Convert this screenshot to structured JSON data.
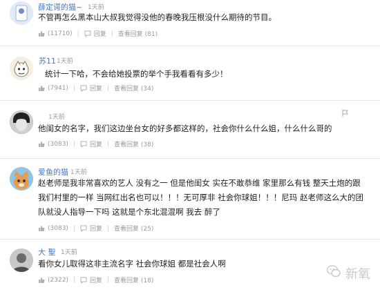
{
  "comments": [
    {
      "user": "薛定谔的猫~",
      "time": "1天前",
      "text": [
        "不管再怎么黑本山大叔我觉得没他的春晚我压根没什么期待的节目。"
      ],
      "likes": "(11710)",
      "reply": "回复",
      "view_replies": "查看回复 (81)"
    },
    {
      "user": "苏11",
      "time": "1天前",
      "text": [
        "统计一下哈，不会给她投票的举个手我看看有多少！"
      ],
      "likes": "(7941)",
      "reply": "回复",
      "view_replies": "查看回复 (34)"
    },
    {
      "user": "",
      "time": "1天前",
      "text": [
        "他闺女的名字，我们这边坐台女的好多都这样的，社会你什么什么姐，什么什么哥的"
      ],
      "likes": "(3083)",
      "reply": "回复",
      "view_replies": "查看回复 (38)"
    },
    {
      "user": "爱鱼的猫",
      "time": "1天前",
      "text": [
        "赵老师是我非常喜欢的艺人  没有之一  但是他闺女  实在不敢恭维  家里那么有钱  整天土炮的跟",
        "我们村里的一样  当网红出名也可以！！！无可厚非  社会你球姐！！！尼玛  赵老师这么大的团",
        "队就没人指导一下吗  这就是个东北混混啊  我去  醉了"
      ],
      "likes": "(3083)",
      "reply": "回复",
      "view_replies": "查看回复 (25)"
    },
    {
      "user": "大  聖",
      "time": "1天前",
      "text": [
        "看你女儿取得这非主流名字  社会你球姐  都是社会人啊"
      ],
      "likes": "(2322)",
      "reply": "回复",
      "view_replies": "查看回复 (18)"
    }
  ],
  "watermark": {
    "text": "新氧",
    "icon": "wechat-icon"
  },
  "icons": {
    "like": "thumb-up-icon",
    "reply": "reply-icon",
    "report": "report-icon"
  }
}
